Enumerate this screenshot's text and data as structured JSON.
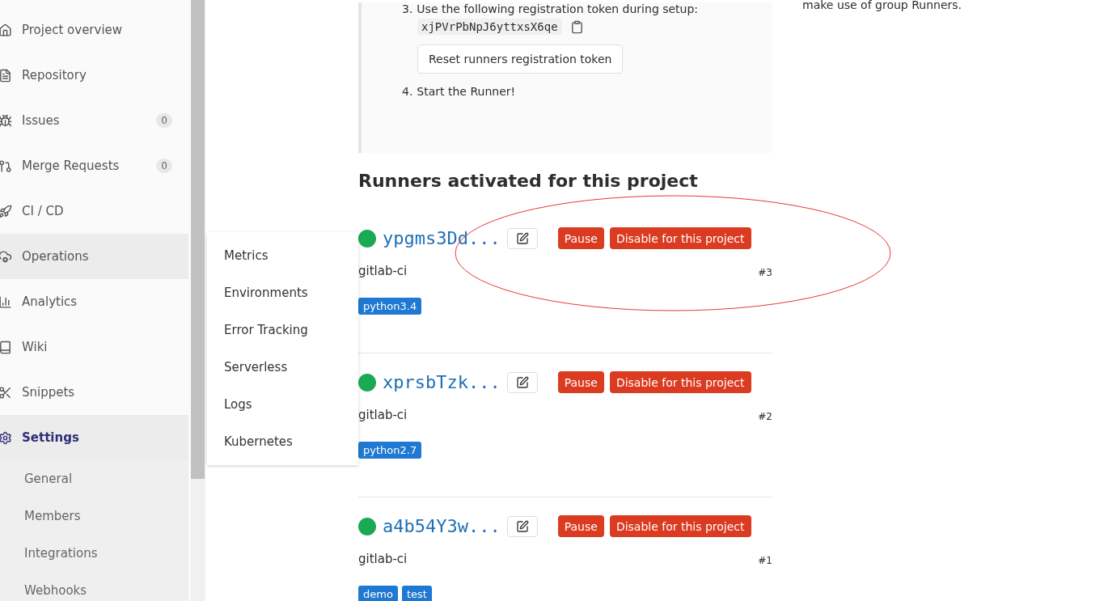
{
  "sidebar": {
    "items": [
      {
        "label": "Project overview",
        "selected": false,
        "expanded": false
      },
      {
        "label": "Repository",
        "selected": false,
        "expanded": false
      },
      {
        "label": "Issues",
        "count": "0",
        "selected": false,
        "expanded": false
      },
      {
        "label": "Merge Requests",
        "count": "0",
        "selected": false,
        "expanded": false
      },
      {
        "label": "CI / CD",
        "selected": false,
        "expanded": false
      },
      {
        "label": "Operations",
        "selected": false,
        "expanded": true
      },
      {
        "label": "Analytics",
        "selected": false,
        "expanded": false
      },
      {
        "label": "Wiki",
        "selected": false,
        "expanded": false
      },
      {
        "label": "Snippets",
        "selected": false,
        "expanded": false
      },
      {
        "label": "Settings",
        "selected": true,
        "expanded": false,
        "children": [
          {
            "label": "General"
          },
          {
            "label": "Members"
          },
          {
            "label": "Integrations"
          },
          {
            "label": "Webhooks"
          }
        ]
      }
    ]
  },
  "flyout_menu": {
    "items": [
      "Metrics",
      "Environments",
      "Error Tracking",
      "Serverless",
      "Logs",
      "Kubernetes"
    ]
  },
  "setup_steps": [
    {
      "number": "3.",
      "text": "Use the following registration token during setup:",
      "token": "xjPVrPbNpJ6yttxsX6qe",
      "button": "Reset runners registration token"
    },
    {
      "number": "4.",
      "text": "Start the Runner!"
    }
  ],
  "side_note": "make use of group Runners.",
  "runners_heading": "Runners activated for this project",
  "runners": [
    {
      "name": "ypgms3Dd...",
      "color": "#1aaa55",
      "description": "gitlab-ci",
      "id": "#3",
      "tags": [
        "python3.4"
      ],
      "pause": "Pause",
      "disable": "Disable for this project"
    },
    {
      "name": "xprsbTzk...",
      "color": "#1aaa55",
      "description": "gitlab-ci",
      "id": "#2",
      "tags": [
        "python2.7"
      ],
      "pause": "Pause",
      "disable": "Disable for this project"
    },
    {
      "name": "a4b54Y3w...",
      "color": "#1aaa55",
      "description": "gitlab-ci",
      "id": "#1",
      "tags": [
        "demo",
        "test"
      ],
      "pause": "Pause",
      "disable": "Disable for this project"
    }
  ],
  "annotation": {
    "kind": "ellipse"
  }
}
